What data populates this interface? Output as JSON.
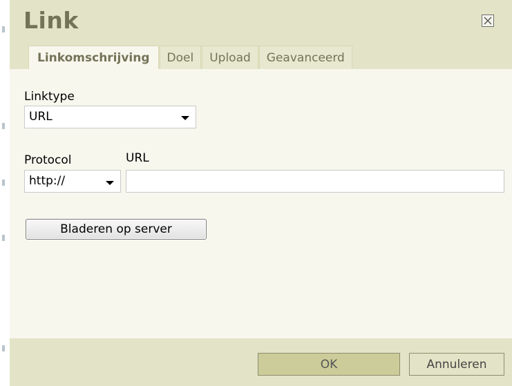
{
  "dialog": {
    "title": "Link",
    "close_icon": "close-icon"
  },
  "tabs": [
    {
      "label": "Linkomschrijving",
      "active": true
    },
    {
      "label": "Doel",
      "active": false
    },
    {
      "label": "Upload",
      "active": false
    },
    {
      "label": "Geavanceerd",
      "active": false
    }
  ],
  "form": {
    "linktype_label": "Linktype",
    "linktype_value": "URL",
    "protocol_label": "Protocol",
    "protocol_value": "http://",
    "url_label": "URL",
    "url_value": "",
    "browse_button": "Bladeren op server"
  },
  "footer": {
    "ok_label": "OK",
    "cancel_label": "Annuleren"
  },
  "colors": {
    "header_bg": "#e3e3c7",
    "body_bg": "#f7f7ee",
    "title_color": "#737357",
    "ok_button_bg": "#cccc9a"
  }
}
